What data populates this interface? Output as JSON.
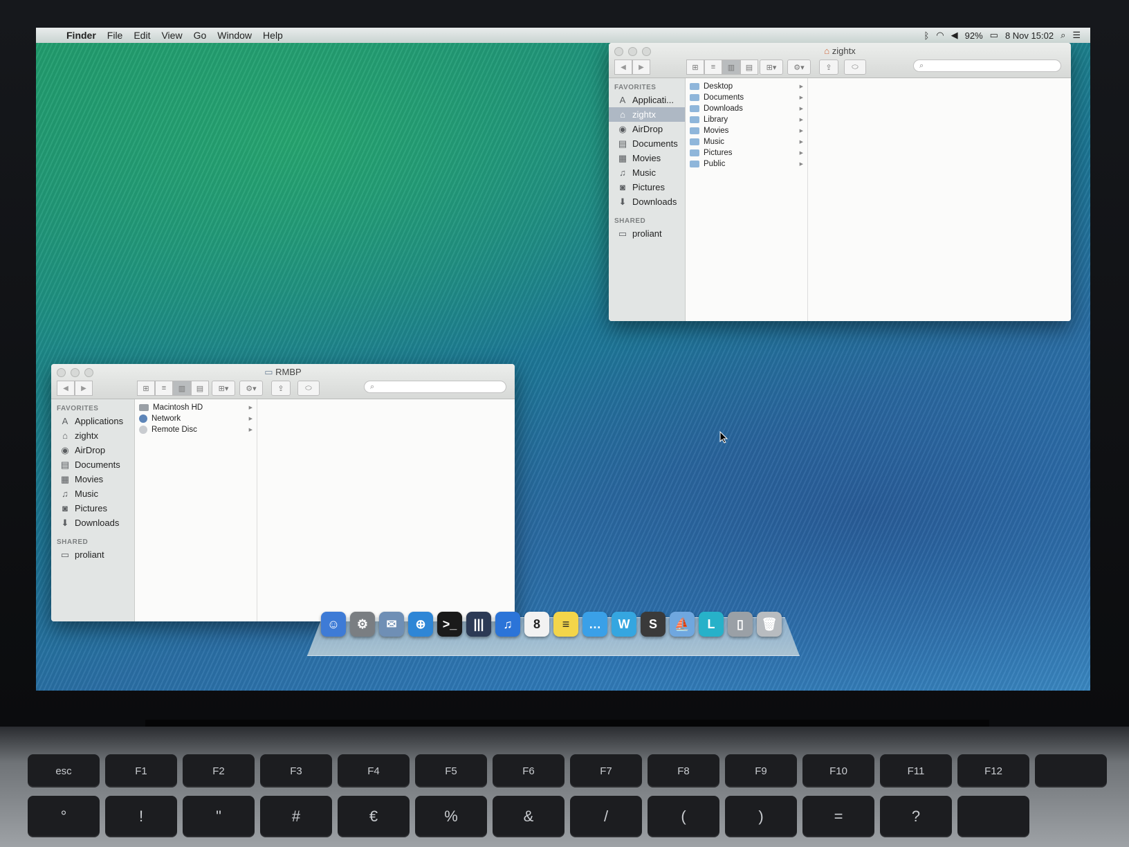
{
  "menubar": {
    "apple": "",
    "items": [
      "Finder",
      "File",
      "Edit",
      "View",
      "Go",
      "Window",
      "Help"
    ],
    "battery": "92%",
    "datetime": "8 Nov  15:02",
    "icons": [
      "bluetooth-icon",
      "wifi-icon",
      "volume-icon",
      "battery-icon",
      "spotlight-icon",
      "notification-center-icon"
    ]
  },
  "window_top": {
    "title": "zightx",
    "sidebar": {
      "favorites_header": "FAVORITES",
      "favorites": [
        {
          "label": "Applicati...",
          "icon": "applications-icon",
          "selected": false
        },
        {
          "label": "zightx",
          "icon": "home-icon",
          "selected": true
        },
        {
          "label": "AirDrop",
          "icon": "airdrop-icon",
          "selected": false
        },
        {
          "label": "Documents",
          "icon": "documents-icon",
          "selected": false
        },
        {
          "label": "Movies",
          "icon": "movies-icon",
          "selected": false
        },
        {
          "label": "Music",
          "icon": "music-icon",
          "selected": false
        },
        {
          "label": "Pictures",
          "icon": "pictures-icon",
          "selected": false
        },
        {
          "label": "Downloads",
          "icon": "downloads-icon",
          "selected": false
        }
      ],
      "shared_header": "SHARED",
      "shared": [
        {
          "label": "proliant",
          "icon": "server-icon"
        }
      ]
    },
    "column_items": [
      "Desktop",
      "Documents",
      "Downloads",
      "Library",
      "Movies",
      "Music",
      "Pictures",
      "Public"
    ]
  },
  "window_bottom": {
    "title": "RMBP",
    "sidebar": {
      "favorites_header": "FAVORITES",
      "favorites": [
        {
          "label": "Applications",
          "icon": "applications-icon"
        },
        {
          "label": "zightx",
          "icon": "home-icon"
        },
        {
          "label": "AirDrop",
          "icon": "airdrop-icon"
        },
        {
          "label": "Documents",
          "icon": "documents-icon"
        },
        {
          "label": "Movies",
          "icon": "movies-icon"
        },
        {
          "label": "Music",
          "icon": "music-icon"
        },
        {
          "label": "Pictures",
          "icon": "pictures-icon"
        },
        {
          "label": "Downloads",
          "icon": "downloads-icon"
        }
      ],
      "shared_header": "SHARED",
      "shared": [
        {
          "label": "proliant",
          "icon": "server-icon"
        }
      ]
    },
    "column_items": [
      "Macintosh HD",
      "Network",
      "Remote Disc"
    ]
  },
  "dock": {
    "items": [
      {
        "name": "finder",
        "glyph": "☺",
        "color": "#3e7bd6"
      },
      {
        "name": "system-preferences",
        "glyph": "⚙",
        "color": "#7a7e82"
      },
      {
        "name": "mail",
        "glyph": "✉",
        "color": "#6f8fb5"
      },
      {
        "name": "safari",
        "glyph": "⊕",
        "color": "#2e86d6"
      },
      {
        "name": "terminal",
        "glyph": ">_",
        "color": "#1a1a1a"
      },
      {
        "name": "mixer",
        "glyph": "|||",
        "color": "#2c3a55"
      },
      {
        "name": "itunes",
        "glyph": "♫",
        "color": "#2b74d8"
      },
      {
        "name": "calendar",
        "glyph": "8",
        "color": "#f2f2f2"
      },
      {
        "name": "stickies",
        "glyph": "≡",
        "color": "#f3d54a"
      },
      {
        "name": "messages",
        "glyph": "…",
        "color": "#3aa0e8"
      },
      {
        "name": "word",
        "glyph": "W",
        "color": "#35a6e0"
      },
      {
        "name": "sublime-text",
        "glyph": "S",
        "color": "#3a3a3a"
      },
      {
        "name": "boat",
        "glyph": "⛵",
        "color": "#6fa7df"
      },
      {
        "name": "lync",
        "glyph": "L",
        "color": "#27b1c9"
      },
      {
        "name": "document-stack",
        "glyph": "▯",
        "color": "#9aa0a6"
      },
      {
        "name": "trash",
        "glyph": "🗑",
        "color": "#b8bcc0"
      }
    ]
  },
  "keyboard": {
    "fn_row": [
      "esc",
      "F1",
      "F2",
      "F3",
      "F4",
      "F5",
      "F6",
      "F7",
      "F8",
      "F9",
      "F10",
      "F11",
      "F12",
      ""
    ],
    "num_row": [
      "°",
      "!",
      "\"",
      "#",
      "€",
      "%",
      "&",
      "/",
      "(",
      ")",
      "=",
      "?",
      ""
    ]
  }
}
